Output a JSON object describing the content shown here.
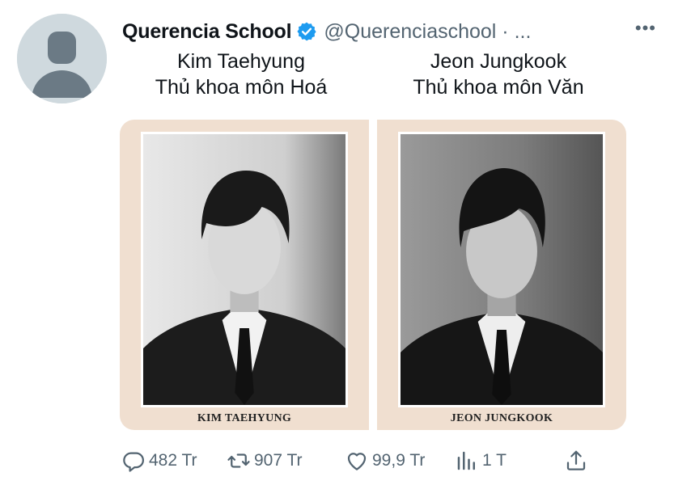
{
  "tweet": {
    "author_name": "Querencia School",
    "handle": "@Querenciaschool · ...",
    "more_label": "•••",
    "captions": {
      "left_line1": "Kim Taehyung",
      "left_line2": "Thủ khoa môn Hoá",
      "right_line1": "Jeon Jungkook",
      "right_line2": "Thủ khoa môn Văn"
    },
    "media": [
      {
        "photo_alt": "Black and white portrait",
        "card_caption": "KIM TAEHYUNG"
      },
      {
        "photo_alt": "Black and white portrait",
        "card_caption": "JEON JUNGKOOK"
      }
    ]
  },
  "actions": {
    "reply_count": "482 Tr",
    "retweet_count": "907 Tr",
    "like_count": "99,9 Tr",
    "views_count": "1 T"
  },
  "colors": {
    "verified": "#1d9bf0",
    "text_secondary": "#536471",
    "card_bg": "#f0dfd0"
  }
}
